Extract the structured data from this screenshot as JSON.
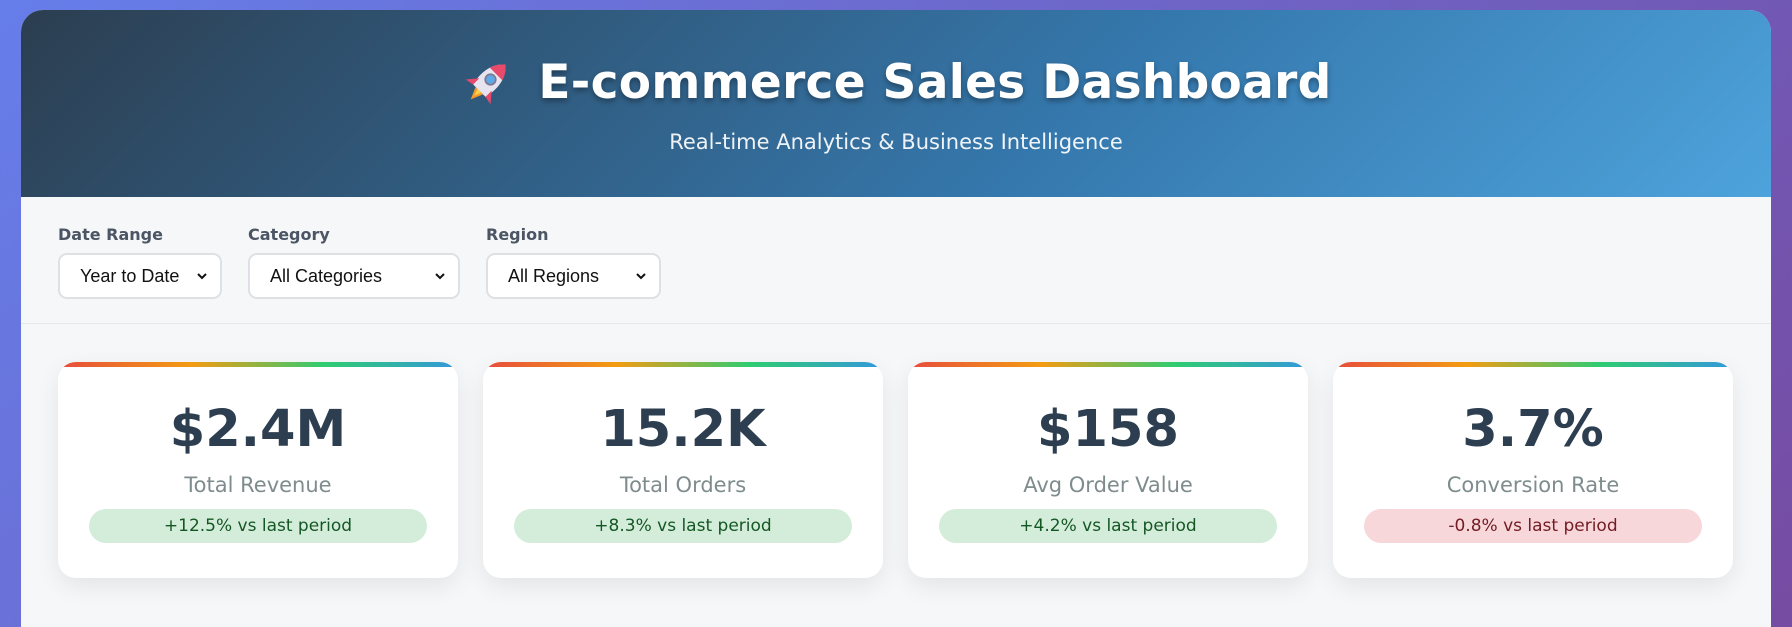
{
  "header": {
    "icon": "rocket-icon",
    "title": "E-commerce Sales Dashboard",
    "subtitle": "Real-time Analytics & Business Intelligence"
  },
  "filters": {
    "date_range": {
      "label": "Date Range",
      "value": "Year to Date"
    },
    "category": {
      "label": "Category",
      "value": "All Categories"
    },
    "region": {
      "label": "Region",
      "value": "All Regions"
    }
  },
  "metrics": [
    {
      "value": "$2.4M",
      "label": "Total Revenue",
      "change": "+12.5% vs last period",
      "trend": "positive"
    },
    {
      "value": "15.2K",
      "label": "Total Orders",
      "change": "+8.3% vs last period",
      "trend": "positive"
    },
    {
      "value": "$158",
      "label": "Avg Order Value",
      "change": "+4.2% vs last period",
      "trend": "positive"
    },
    {
      "value": "3.7%",
      "label": "Conversion Rate",
      "change": "-0.8% vs last period",
      "trend": "negative"
    }
  ],
  "colors": {
    "positive_bg": "#d4edda",
    "positive_text": "#155724",
    "negative_bg": "#f8d7da",
    "negative_text": "#721c24",
    "card_accent": [
      "#e74c3c",
      "#f39c12",
      "#2ecc71",
      "#3498db"
    ]
  }
}
